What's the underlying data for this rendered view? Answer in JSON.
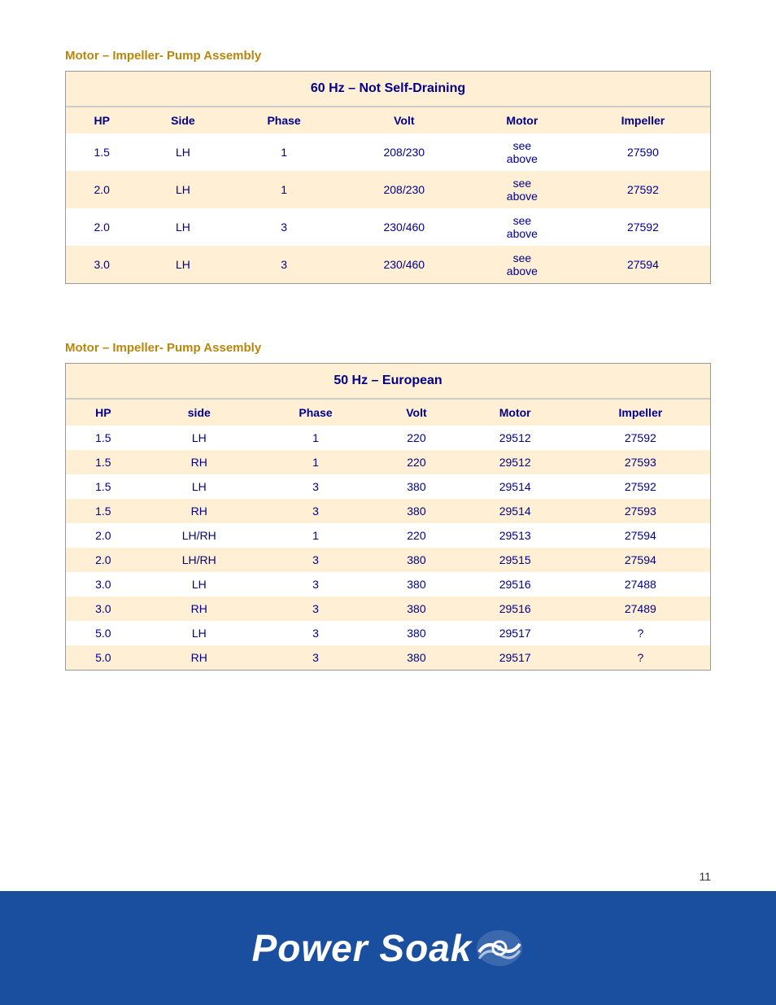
{
  "page": {
    "number": "11"
  },
  "section1": {
    "title": "Motor – Impeller- Pump Assembly",
    "table_title": "60 Hz – Not Self-Draining",
    "columns": [
      "HP",
      "Side",
      "Phase",
      "Volt",
      "Motor",
      "Impeller"
    ],
    "rows": [
      [
        "1.5",
        "LH",
        "1",
        "208/230",
        "see\nabove",
        "27590"
      ],
      [
        "2.0",
        "LH",
        "1",
        "208/230",
        "see\nabove",
        "27592"
      ],
      [
        "2.0",
        "LH",
        "3",
        "230/460",
        "see\nabove",
        "27592"
      ],
      [
        "3.0",
        "LH",
        "3",
        "230/460",
        "see\nabove",
        "27594"
      ]
    ]
  },
  "section2": {
    "title": "Motor – Impeller- Pump Assembly",
    "table_title": "50 Hz – European",
    "columns": [
      "HP",
      "side",
      "Phase",
      "Volt",
      "Motor",
      "Impeller"
    ],
    "rows": [
      [
        "1.5",
        "LH",
        "1",
        "220",
        "29512",
        "27592"
      ],
      [
        "1.5",
        "RH",
        "1",
        "220",
        "29512",
        "27593"
      ],
      [
        "1.5",
        "LH",
        "3",
        "380",
        "29514",
        "27592"
      ],
      [
        "1.5",
        "RH",
        "3",
        "380",
        "29514",
        "27593"
      ],
      [
        "2.0",
        "LH/RH",
        "1",
        "220",
        "29513",
        "27594"
      ],
      [
        "2.0",
        "LH/RH",
        "3",
        "380",
        "29515",
        "27594"
      ],
      [
        "3.0",
        "LH",
        "3",
        "380",
        "29516",
        "27488"
      ],
      [
        "3.0",
        "RH",
        "3",
        "380",
        "29516",
        "27489"
      ],
      [
        "5.0",
        "LH",
        "3",
        "380",
        "29517",
        "?"
      ],
      [
        "5.0",
        "RH",
        "3",
        "380",
        "29517",
        "?"
      ]
    ]
  },
  "footer": {
    "logo_text": "Power Soak"
  }
}
